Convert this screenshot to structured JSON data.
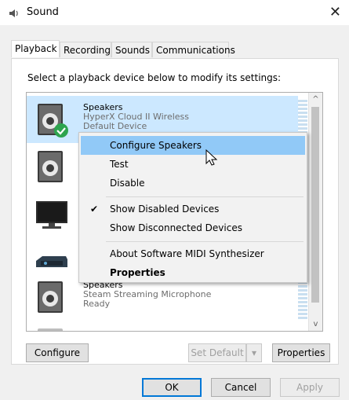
{
  "window": {
    "title": "Sound",
    "close_glyph": "✕"
  },
  "tabs": [
    "Playback",
    "Recording",
    "Sounds",
    "Communications"
  ],
  "instruction": "Select a playback device below to modify its settings:",
  "devices": [
    {
      "name": "Speakers",
      "description": "HyperX Cloud II Wireless",
      "status": "Default Device",
      "icon": "speaker-icon"
    },
    {
      "name": "",
      "description": "",
      "status": "",
      "icon": "speaker-icon"
    },
    {
      "name": "",
      "description": "",
      "status": "",
      "icon": "monitor-icon"
    },
    {
      "name": "",
      "description": "",
      "status": "",
      "icon": "receiver-icon"
    },
    {
      "name": "Speakers",
      "description": "Steam Streaming Microphone",
      "status": "Ready",
      "icon": "speaker-icon"
    }
  ],
  "context_menu": {
    "items": [
      "Configure Speakers",
      "Test",
      "Disable",
      "Show Disabled Devices",
      "Show Disconnected Devices",
      "About Software MIDI Synthesizer",
      "Properties"
    ],
    "checked": "Show Disabled Devices",
    "highlighted": "Configure Speakers"
  },
  "buttons": {
    "configure": "Configure",
    "set_default": "Set Default",
    "properties": "Properties",
    "ok": "OK",
    "cancel": "Cancel",
    "apply": "Apply"
  },
  "scroll": {
    "up_glyph": "^",
    "down_glyph": "v"
  },
  "colors": {
    "selection": "#cce8ff",
    "menu_highlight": "#91c9f7",
    "accent": "#0078d7",
    "default_check": "#2da44e"
  }
}
